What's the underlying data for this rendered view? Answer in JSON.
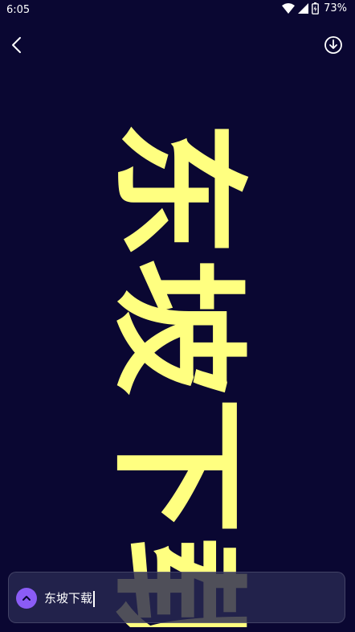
{
  "status_bar": {
    "time": "6:05",
    "battery": "73%"
  },
  "preview": {
    "text": "东坡下载",
    "text_color": "#ffff80",
    "background_color": "#0a0732"
  },
  "input": {
    "value": "东坡下载"
  },
  "colors": {
    "accent": "#8b5cf6"
  },
  "icons": {
    "back": "chevron-left-icon",
    "download": "download-circle-icon",
    "expand": "chevron-up-icon"
  }
}
